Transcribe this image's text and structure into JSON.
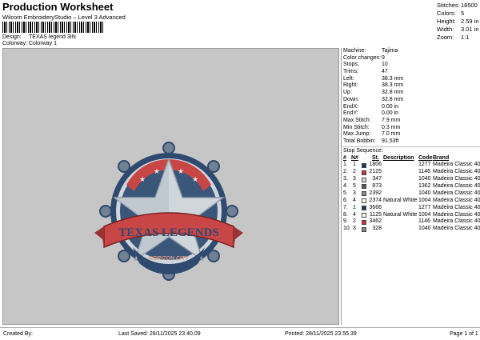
{
  "header": {
    "title": "Production Worksheet",
    "subtitle": "Wilcom EmbroideryStudio – Level 3 Advanced",
    "design_label": "Design:",
    "design_value": "TEXAS legend 3IN",
    "colorway_label": "Colorway:",
    "colorway_value": "Colorway 1"
  },
  "summary": [
    {
      "label": "Stitches:",
      "value": "18500"
    },
    {
      "label": "Colors:",
      "value": "5"
    },
    {
      "label": "Height:",
      "value": "2.59 in"
    },
    {
      "label": "Width:",
      "value": "3.01 in"
    },
    {
      "label": "Zoom:",
      "value": "1:1"
    }
  ],
  "specs": [
    {
      "label": "Machine:",
      "value": "Tajima"
    },
    {
      "label": "Color changes:",
      "value": "9"
    },
    {
      "label": "Stops:",
      "value": "10"
    },
    {
      "label": "Trims:",
      "value": "47"
    },
    {
      "label": "Left:",
      "value": "38.3 mm"
    },
    {
      "label": "Right:",
      "value": "38.3 mm"
    },
    {
      "label": "Up:",
      "value": "32.8 mm"
    },
    {
      "label": "Down:",
      "value": "32.8 mm"
    },
    {
      "label": "EndX:",
      "value": "0.00 in"
    },
    {
      "label": "EndY:",
      "value": "0.00 in"
    },
    {
      "label": "Max Stitch:",
      "value": "7.9 mm"
    },
    {
      "label": "Min Stitch:",
      "value": "0.3 mm"
    },
    {
      "label": "Max Jump:",
      "value": "7.0 mm"
    },
    {
      "label": "Total Bobbin:",
      "value": "91.53ft"
    }
  ],
  "sequence": {
    "title": "Stop Sequence:",
    "headers": {
      "stop": "#",
      "n": "N#",
      "st": "St.",
      "desc": "Description",
      "code": "Code",
      "brand": "Brand"
    },
    "rows": [
      {
        "stop": "1.",
        "n": "1",
        "color": "#1f3a5a",
        "st": "1806",
        "desc": "",
        "code": "1277",
        "brand": "Madeira Classic 40"
      },
      {
        "stop": "2.",
        "n": "2",
        "color": "#cc3333",
        "st": "2125",
        "desc": "",
        "code": "1146",
        "brand": "Madeira Classic 40"
      },
      {
        "stop": "3.",
        "n": "3",
        "color": "#dcdcdc",
        "st": "347",
        "desc": "",
        "code": "1040",
        "brand": "Madeira Classic 40"
      },
      {
        "stop": "4.",
        "n": "5",
        "color": "#555555",
        "st": "873",
        "desc": "",
        "code": "1362",
        "brand": "Madeira Classic 40"
      },
      {
        "stop": "5.",
        "n": "3",
        "color": "#888888",
        "st": "2392",
        "desc": "",
        "code": "1040",
        "brand": "Madeira Classic 40"
      },
      {
        "stop": "6.",
        "n": "4",
        "color": "#ffffff",
        "st": "2374",
        "desc": "Natural White",
        "code": "1004",
        "brand": "Madeira Classic 40"
      },
      {
        "stop": "7.",
        "n": "1",
        "color": "#1f3a5a",
        "st": "3666",
        "desc": "",
        "code": "1277",
        "brand": "Madeira Classic 40"
      },
      {
        "stop": "8.",
        "n": "4",
        "color": "#ffffff",
        "st": "1125",
        "desc": "Natural White",
        "code": "1004",
        "brand": "Madeira Classic 40"
      },
      {
        "stop": "9.",
        "n": "2",
        "color": "#cc3333",
        "st": "3462",
        "desc": "",
        "code": "1146",
        "brand": "Madeira Classic 40"
      },
      {
        "stop": "10.",
        "n": "3",
        "color": "#888888",
        "st": "328",
        "desc": "",
        "code": "1040",
        "brand": "Madeira Classic 40"
      }
    ]
  },
  "design": {
    "banner_text": "TEXAS LEGENDS",
    "city_text": "HORIZON CITY"
  },
  "footer": {
    "created_by": "Created By:",
    "last_saved": "Last Saved: 28/11/2025 23.40.09",
    "printed": "Printed: 28/11/2025 23.55.39",
    "page": "Page 1 of 1"
  }
}
